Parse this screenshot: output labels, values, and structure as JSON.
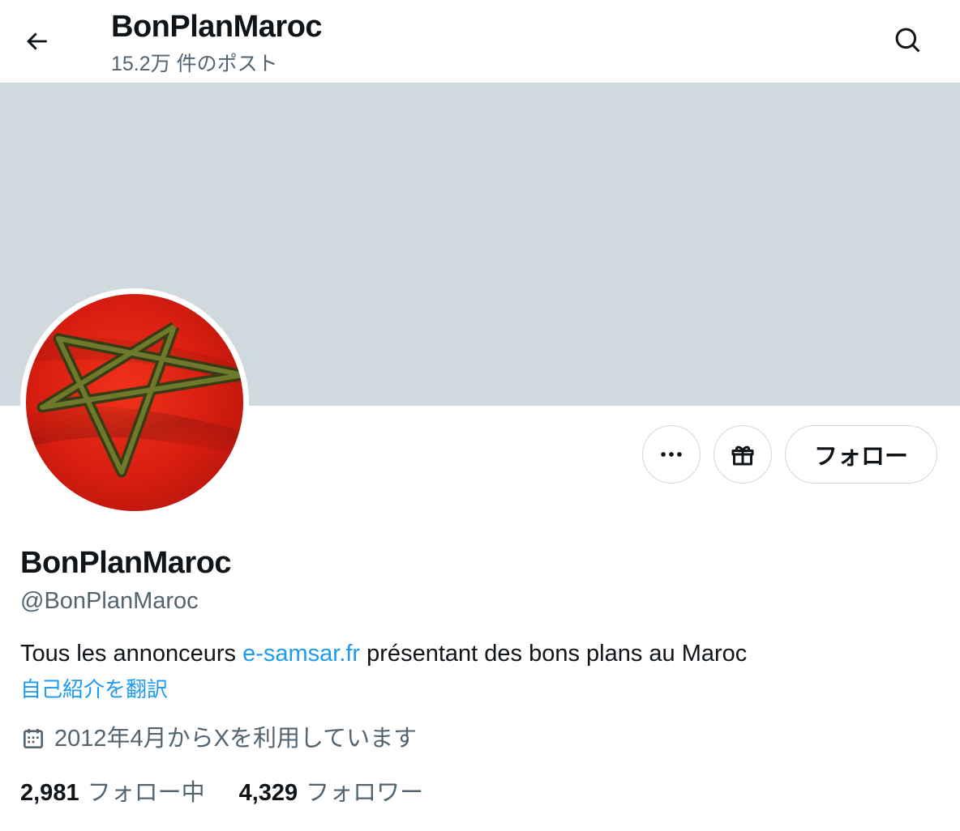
{
  "header": {
    "title": "BonPlanMaroc",
    "post_count": "15.2万 件のポスト",
    "back_icon": "arrow-left-icon",
    "search_icon": "search-icon"
  },
  "colors": {
    "banner": "#cfd9de",
    "link": "#1d9bf0",
    "muted_text": "#536471",
    "text": "#0f1419"
  },
  "actions": {
    "more_icon": "more-dots-icon",
    "gift_icon": "gift-icon",
    "follow_label": "フォロー"
  },
  "profile": {
    "display_name": "BonPlanMaroc",
    "handle": "@BonPlanMaroc",
    "bio_before": "Tous les annonceurs ",
    "bio_link": "e-samsar.fr",
    "bio_after": " présentant des bons plans au Maroc",
    "translate_label": "自己紹介を翻訳",
    "joined_icon": "calendar-icon",
    "joined": "2012年4月からXを利用しています"
  },
  "stats": {
    "following_count": "2,981",
    "following_label": "フォロー中",
    "followers_count": "4,329",
    "followers_label": "フォロワー"
  }
}
